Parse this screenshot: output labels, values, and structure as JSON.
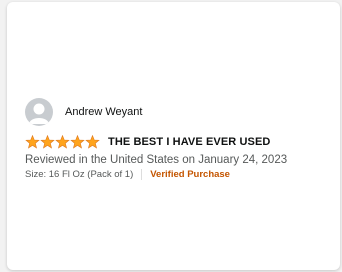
{
  "review": {
    "author": "Andrew Weyant",
    "rating": 5,
    "rating_max": 5,
    "title": "THE BEST I HAVE EVER USED",
    "meta": "Reviewed in the United States on January 24, 2023",
    "size": "Size: 16 Fl Oz (Pack of 1)",
    "verified": "Verified Purchase"
  },
  "icons": {
    "avatar": "avatar-icon",
    "star": "star-icon"
  },
  "colors": {
    "star": "#ffa41c",
    "verified": "#c45500",
    "text_primary": "#0f1111",
    "text_secondary": "#565959"
  }
}
